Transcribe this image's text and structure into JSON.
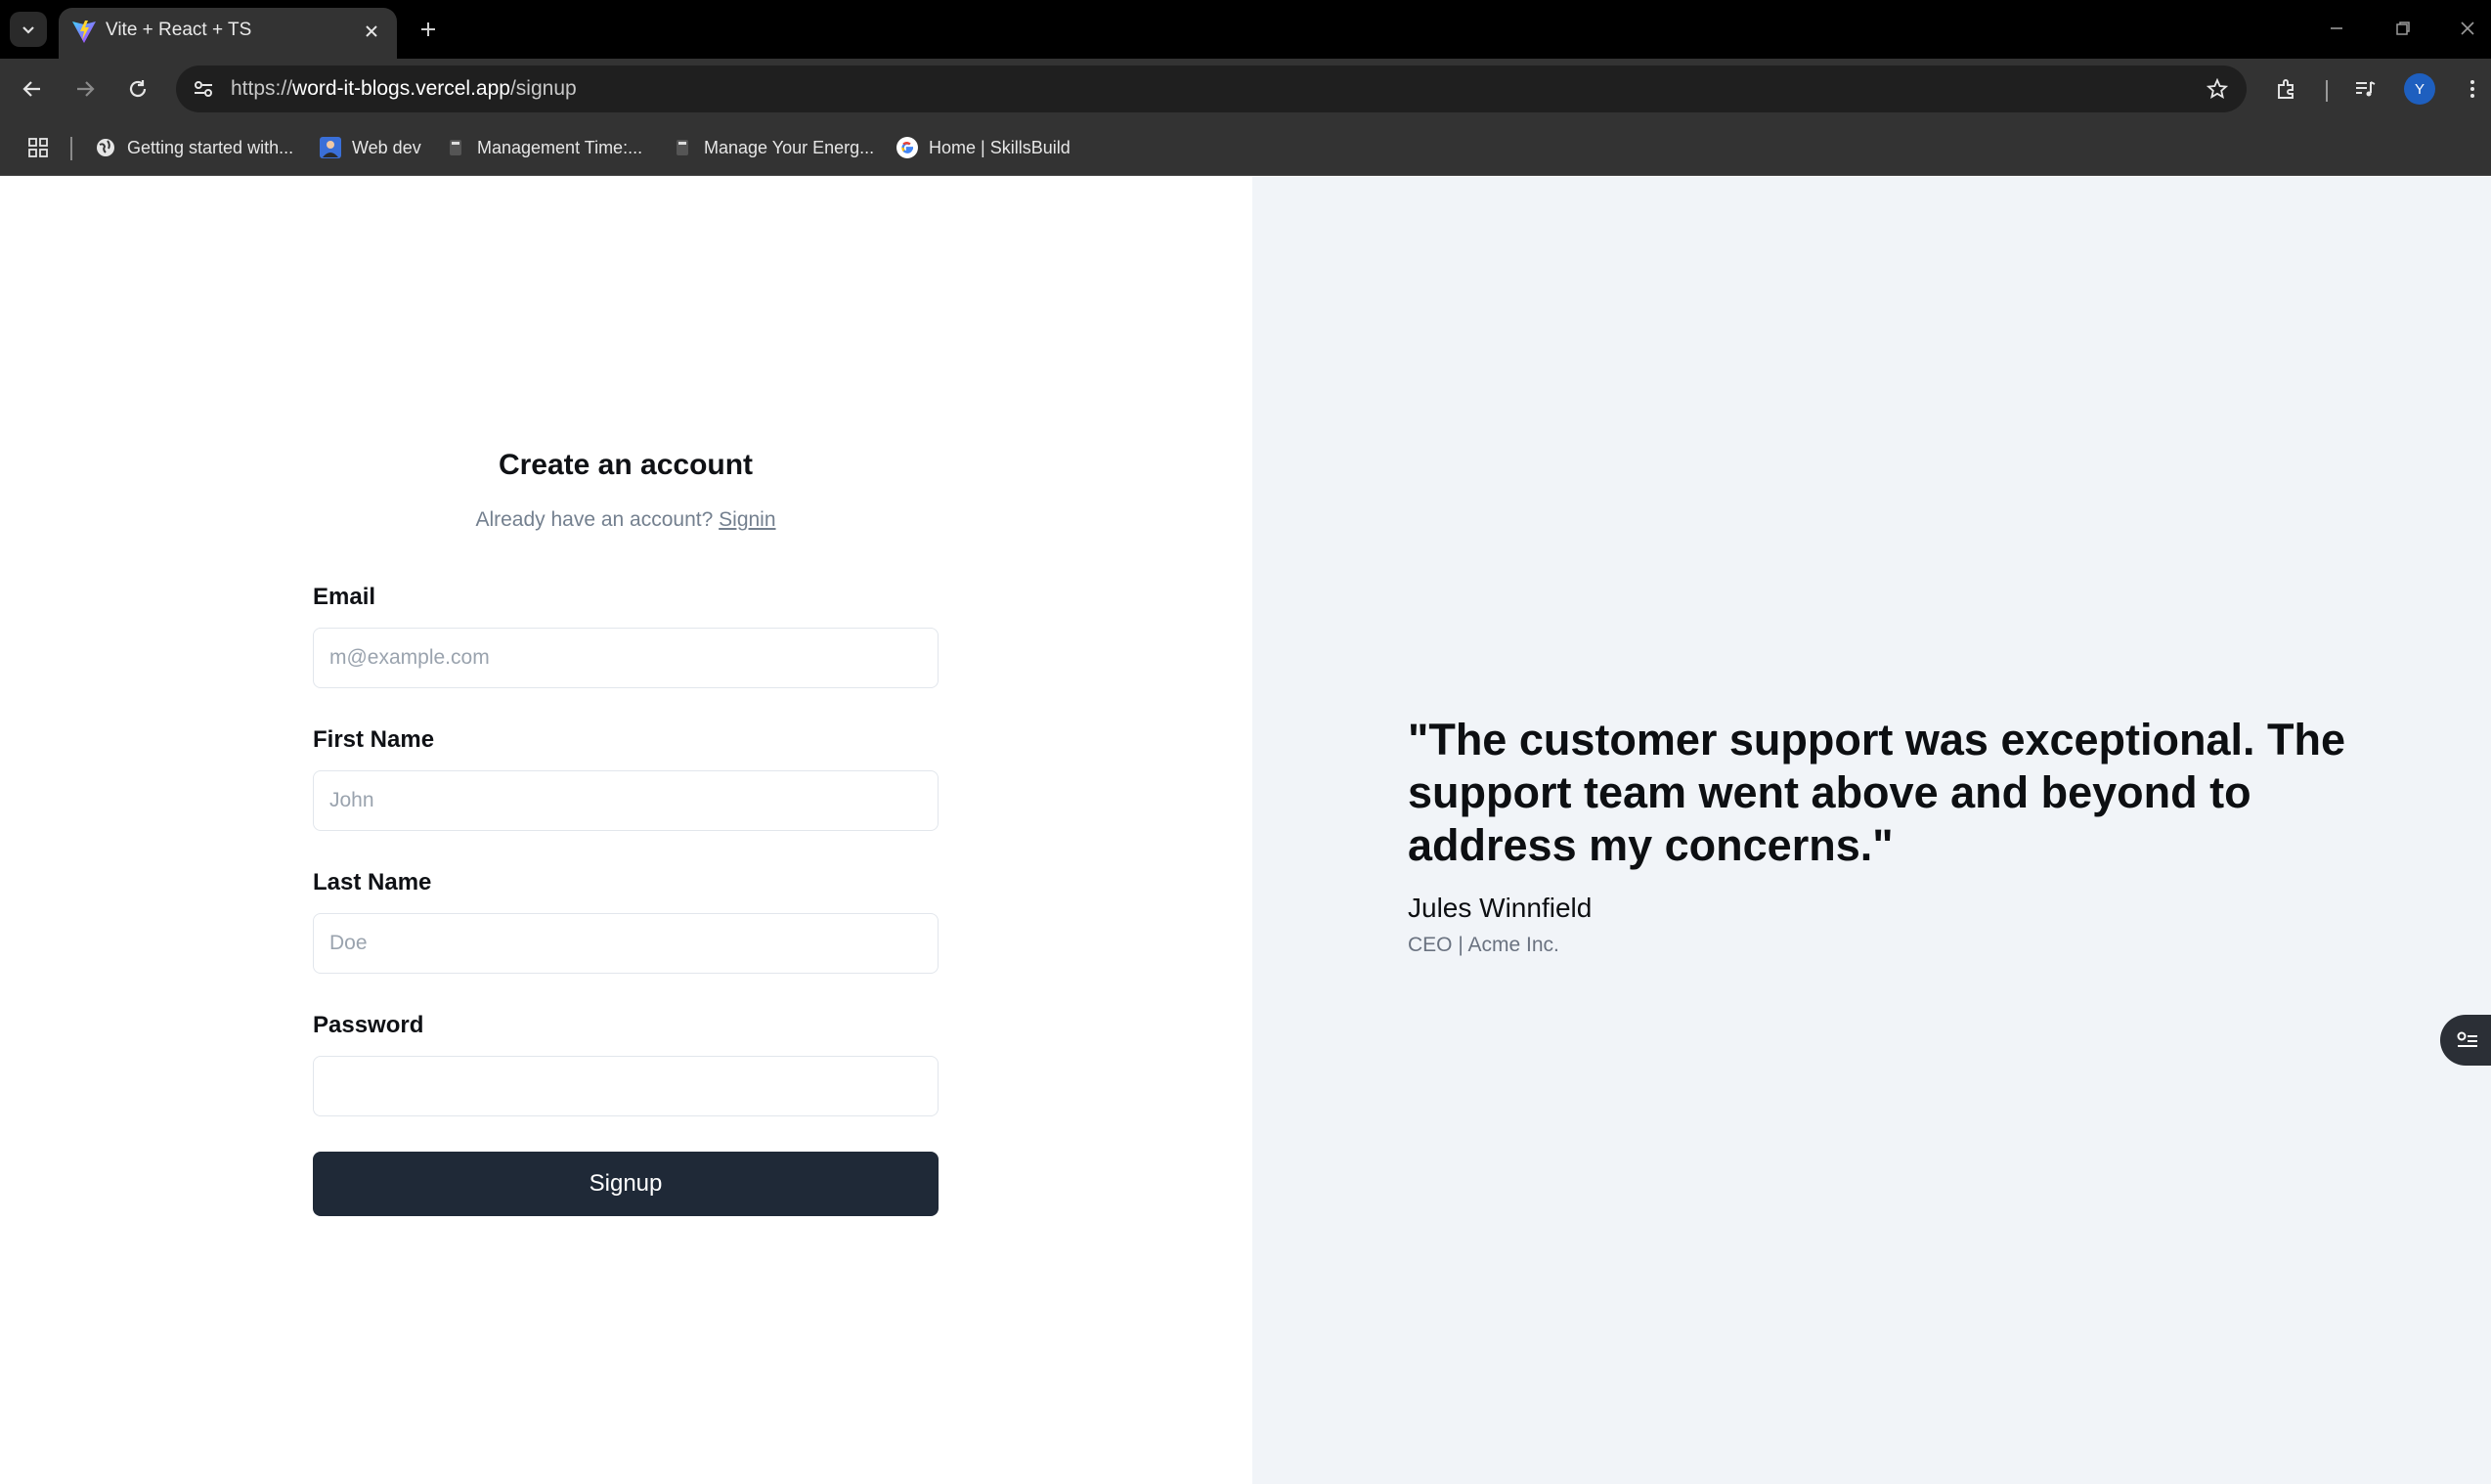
{
  "browser": {
    "tab": {
      "title": "Vite + React + TS",
      "favicon": "vite-logo-icon"
    },
    "address": {
      "scheme": "https://",
      "host": "word-it-blogs.vercel.app",
      "path": "/signup"
    },
    "profile_initial": "Y",
    "bookmarks": [
      {
        "label": "Getting started with...",
        "icon": "globe-icon"
      },
      {
        "label": "Web dev",
        "icon": "avatar-thumbnail-icon"
      },
      {
        "label": "Management Time:...",
        "icon": "hbr-icon"
      },
      {
        "label": "Manage Your Energ...",
        "icon": "hbr-icon"
      },
      {
        "label": "Home | SkillsBuild",
        "icon": "google-icon"
      }
    ]
  },
  "form": {
    "heading": "Create an account",
    "subtext": "Already have an account?",
    "signin_link": "Signin",
    "fields": {
      "email": {
        "label": "Email",
        "placeholder": "m@example.com",
        "value": ""
      },
      "first_name": {
        "label": "First Name",
        "placeholder": "John",
        "value": ""
      },
      "last_name": {
        "label": "Last Name",
        "placeholder": "Doe",
        "value": ""
      },
      "password": {
        "label": "Password",
        "placeholder": "",
        "value": ""
      }
    },
    "submit_label": "Signup"
  },
  "testimonial": {
    "quote": "\"The customer support was exceptional. The support team went above and beyond to address my concerns.\"",
    "author": "Jules Winnfield",
    "author_title": "CEO | Acme Inc."
  },
  "colors": {
    "button_bg": "#1f2937",
    "right_panel_bg": "#f1f4f8",
    "muted_text": "#74808f"
  }
}
